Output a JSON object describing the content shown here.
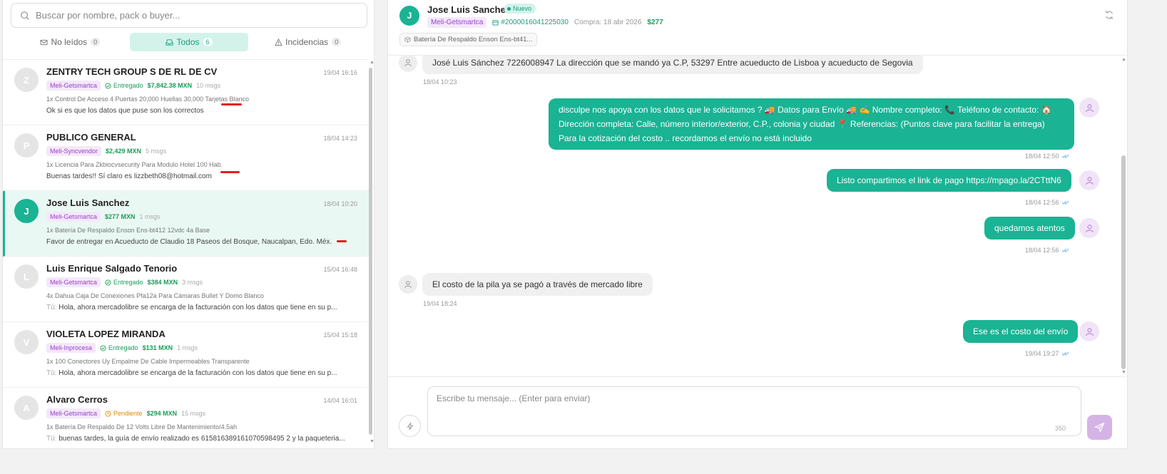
{
  "search": {
    "placeholder": "Buscar por nombre, pack o buyer..."
  },
  "filters": [
    {
      "label": "No leídos",
      "count": "0",
      "icon": "mail-icon"
    },
    {
      "label": "Todos",
      "count": "6",
      "icon": "inbox-icon"
    },
    {
      "label": "Incidencias",
      "count": "0",
      "icon": "warning-icon"
    }
  ],
  "conversations": [
    {
      "initial": "Z",
      "name": "ZENTRY TECH GROUP S DE RL DE CV",
      "time": "19/04 16:16",
      "store": "Meli-Getsmartca",
      "status": "Entregado",
      "amount": "$7,842.38 MXN",
      "msgs": "10 msgs",
      "product": "1x Control De Acceso 4 Puertas 20,000 Huellas 30,000 Tarjetas Blanco",
      "last_prefix": "",
      "last": "Ok si es que los datos que puse son los correctos"
    },
    {
      "initial": "P",
      "name": "PUBLICO GENERAL",
      "time": "18/04 14:23",
      "store": "Meli-Syncvendor",
      "status": "",
      "amount": "$2,429 MXN",
      "msgs": "5 msgs",
      "product": "1x Licencia Para Zkbiocvsecurity Para Modulo Hotel 100 Hab.",
      "last_prefix": "",
      "last": "Buenas tardes!! Sí claro es lizzbeth08@hotmail.com"
    },
    {
      "initial": "J",
      "name": "Jose Luis Sanchez",
      "time": "18/04 10:20",
      "store": "Meli-Getsmartca",
      "status": "",
      "amount": "$277 MXN",
      "msgs": "1 msgs",
      "product": "1x Batería De Respaldo Enson Ens-bt412 12vdc 4a Base",
      "last_prefix": "",
      "last": "Favor de entregar en Acueducto de Claudio 18 Paseos del Bosque, Naucalpan, Edo. Méx."
    },
    {
      "initial": "L",
      "name": "Luis Enrique Salgado Tenorio",
      "time": "15/04 16:48",
      "store": "Meli-Getsmartca",
      "status": "Entregado",
      "amount": "$384 MXN",
      "msgs": "3 msgs",
      "product": "4x Dahua Caja De Conexiones Pfa12a Para Cámaras Bullet Y Domo Blanco",
      "last_prefix": "Tú:",
      "last": "Hola, ahora mercadolibre se encarga de la facturación con los datos que tiene en su p..."
    },
    {
      "initial": "V",
      "name": "VIOLETA LOPEZ MIRANDA",
      "time": "15/04 15:18",
      "store": "Meli-Inprocesa",
      "status": "Entregado",
      "amount": "$131 MXN",
      "msgs": "1 msgs",
      "product": "1x 100 Conectores Uy Empalme De Cable Impermeables Transparente",
      "last_prefix": "Tú:",
      "last": "Hola, ahora mercadolibre se encarga de la facturación con los datos que tiene en su p..."
    },
    {
      "initial": "A",
      "name": "Alvaro Cerros",
      "time": "14/04 16:01",
      "store": "Meli-Getsmartca",
      "status": "Pendiente",
      "amount": "$294 MXN",
      "msgs": "15 msgs",
      "product": "1x Batería De Respaldo De 12 Volts Libre De Mantenimiento/4.5ah",
      "last_prefix": "Tú:",
      "last": "buenas tardes, la guía de envío realizado es 615816389161070598495 2 y la paqueteria..."
    }
  ],
  "header": {
    "initial": "J",
    "name": "Jose Luis Sanchez",
    "badge": "Nuevo",
    "store": "Meli-Getsmartca",
    "order": "#2000016041225030",
    "purchase": "Compra: 18 abr 2026",
    "amount": "$277",
    "product_chip": "Batería De Respaldo Enson Ens-bt41..."
  },
  "messages": [
    {
      "dir": "in",
      "text": "José Luis Sánchez 7226008947 La dirección que se mandó ya C.P, 53297 Entre acueducto de Lisboa y acueducto de Segovia",
      "time": "18/04 10:23"
    },
    {
      "dir": "out",
      "text": "disculpe nos apoya con los datos que le solicitamos ? 🚚 Datos para Envío 🚚 ✍ Nombre completo: 📞 Teléfono de contacto: 🏠 Dirección completa: Calle, número interior/exterior, C.P., colonia y ciudad 📍 Referencias: (Puntos clave para facilitar la entrega) Para la cotización del costo .. recordamos el envío no está incluido",
      "time": "18/04 12:50"
    },
    {
      "dir": "out",
      "text": "Listo compartimos el link de pago https://mpago.la/2CTttN6",
      "time": "18/04 12:56"
    },
    {
      "dir": "out",
      "text": "quedamos atentos",
      "time": "18/04 12:56"
    },
    {
      "dir": "in",
      "text": "El costo de la pila ya se pagó a través de mercado libre",
      "time": "19/04 18:24"
    },
    {
      "dir": "out",
      "text": "Ese es el costo del envío",
      "time": "19/04 19:27"
    }
  ],
  "composer": {
    "placeholder": "Escribe tu mensaje... (Enter para enviar)",
    "counter": "350"
  },
  "colors": {
    "accent": "#1ab394",
    "store_tag": "#9b3fc8",
    "delivered": "#1a9c5a",
    "pending": "#e08a00",
    "send_button": "#d6b3e6"
  }
}
